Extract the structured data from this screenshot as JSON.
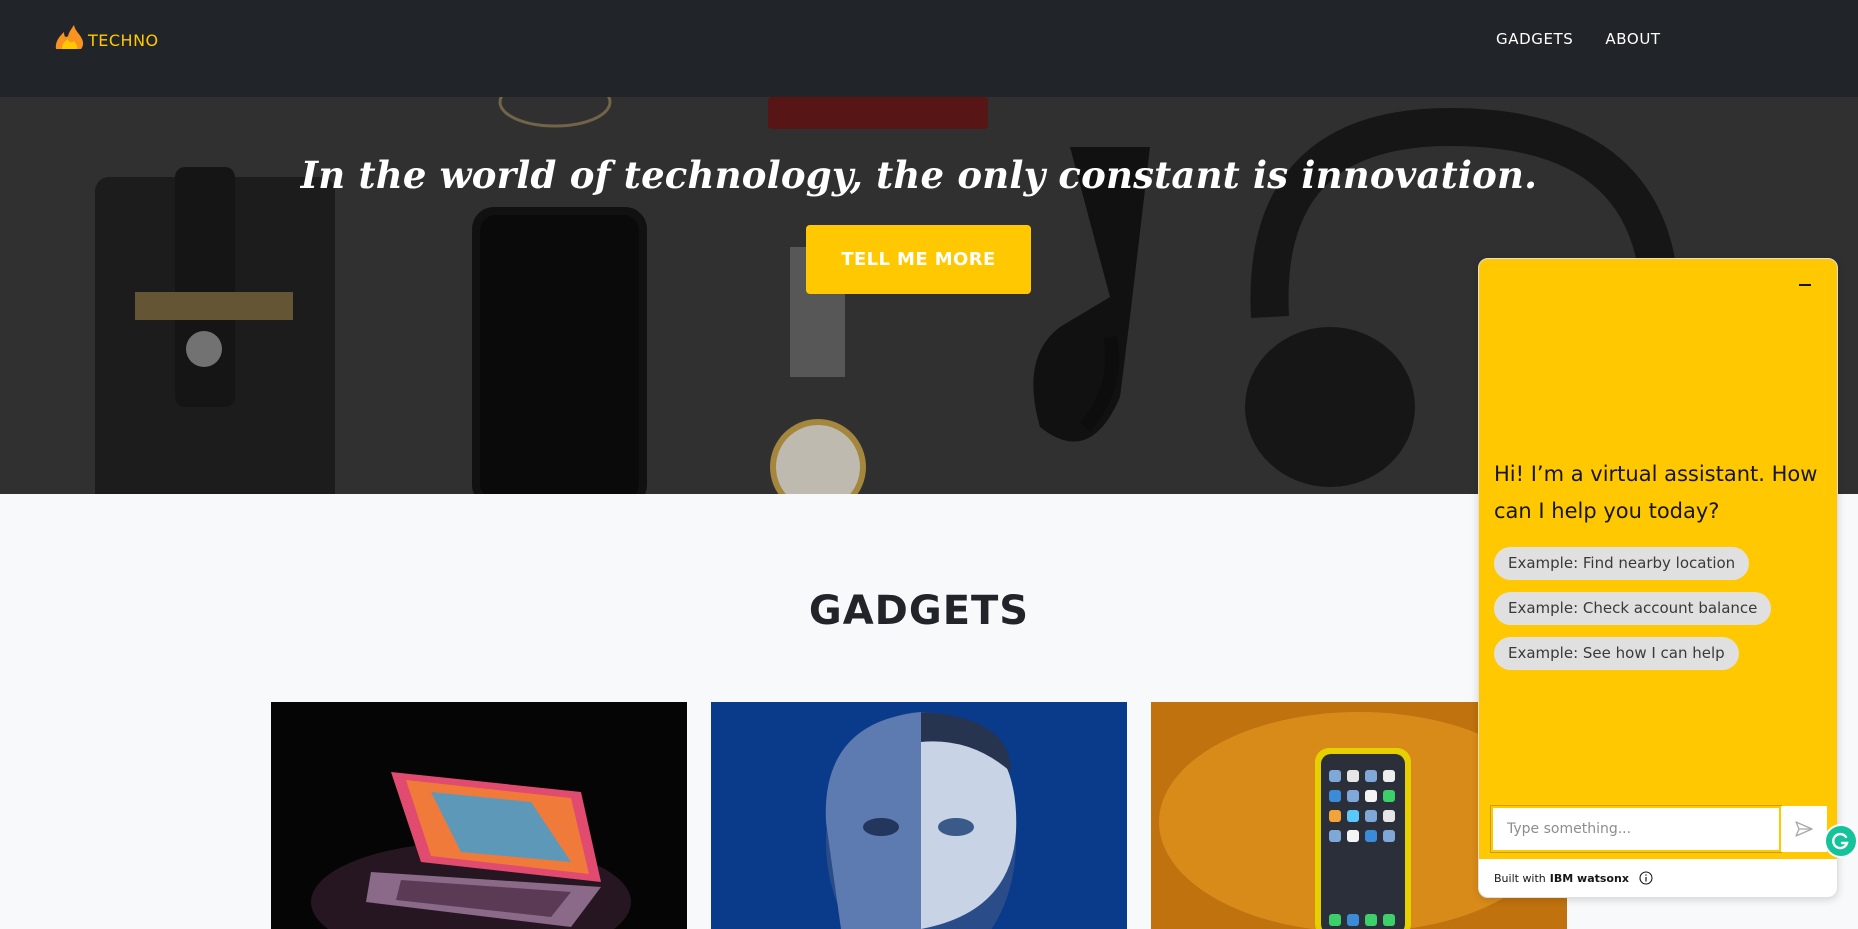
{
  "navbar": {
    "brand_text": "TECHNO",
    "links": [
      {
        "label": "GADGETS"
      },
      {
        "label": "ABOUT"
      }
    ]
  },
  "hero": {
    "quote": "In the world of technology, the only constant is innovation.",
    "cta_label": "TELL ME MORE"
  },
  "gadgets": {
    "heading": "GADGETS",
    "cards": [
      {
        "subject": "laptop"
      },
      {
        "subject": "cyborg-face"
      },
      {
        "subject": "smartphone"
      }
    ]
  },
  "chat": {
    "greeting": "Hi! I’m a virtual assistant. How can I help you today?",
    "examples": [
      "Example: Find nearby location",
      "Example: Check account balance",
      "Example: See how I can help"
    ],
    "input_placeholder": "Type something...",
    "footer_prefix": "Built with",
    "footer_brand": "IBM watsonx"
  },
  "colors": {
    "accent": "#ffc800",
    "navbar_bg": "#212529",
    "page_bg": "#f8f9fa"
  }
}
